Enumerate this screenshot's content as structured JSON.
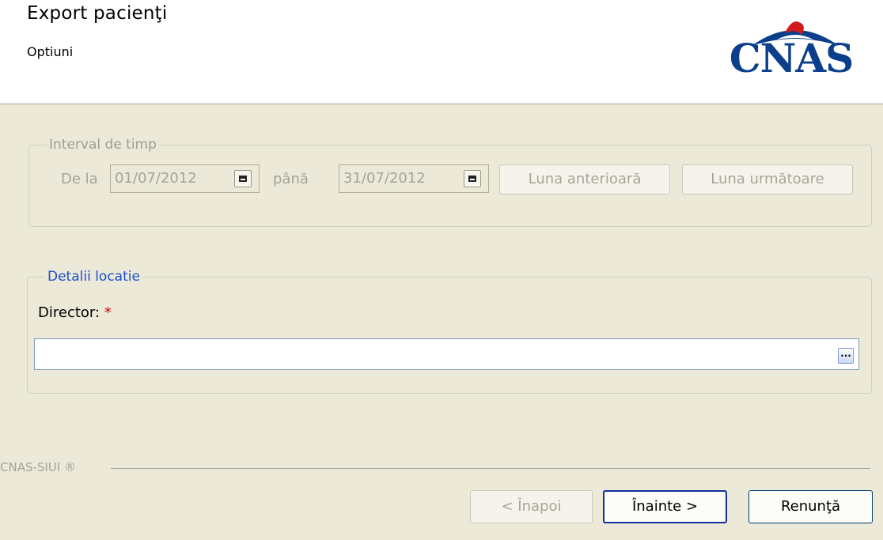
{
  "header": {
    "title": "Export pacienţi",
    "subtitle": "Optiuni",
    "logo_text": "CNAS"
  },
  "interval": {
    "legend": "Interval de timp",
    "from_label": "De la",
    "from_value": "01/07/2012",
    "to_label": "până",
    "to_value": "31/07/2012",
    "prev_month_label": "Luna anterioară",
    "next_month_label": "Luna următoare"
  },
  "location": {
    "legend": "Detalii locatie",
    "director_label": "Director:",
    "required_mark": "*",
    "director_value": "",
    "browse_label": "..."
  },
  "footer": {
    "brand": "CNAS-SIUI ®",
    "back_label": "< Înapoi",
    "next_label": "Înainte >",
    "cancel_label": "Renunţă"
  },
  "colors": {
    "background": "#ece9d8",
    "accent_legend": "#1b4fd0",
    "logo_blue": "#0b3f8c",
    "logo_red": "#d21a1a",
    "required": "#d40000"
  }
}
